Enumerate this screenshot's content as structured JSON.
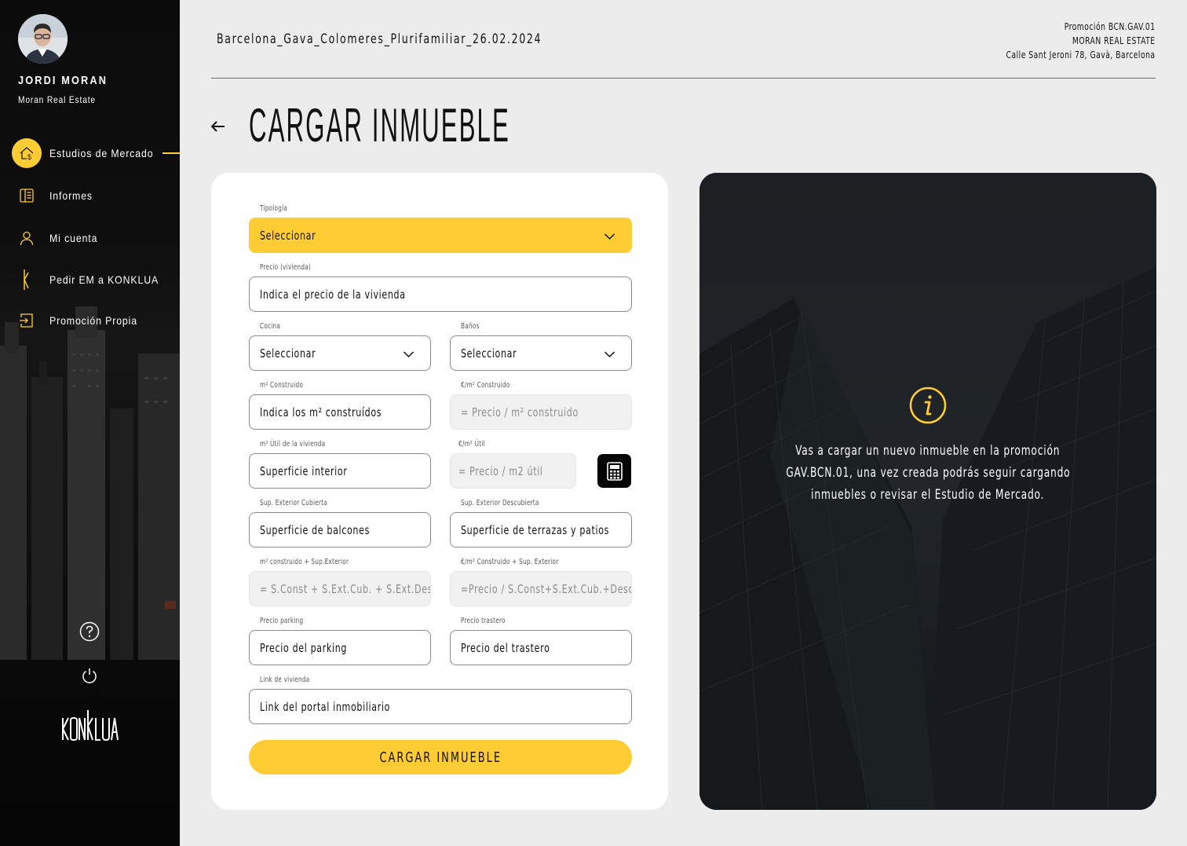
{
  "user": {
    "name": "JORDI MORAN",
    "company": "Moran Real Estate"
  },
  "sidebar": {
    "items": [
      {
        "label": "Estudios de Mercado",
        "icon": "house-euro-icon",
        "active": true
      },
      {
        "label": "Informes",
        "icon": "report-icon",
        "active": false
      },
      {
        "label": "Mi cuenta",
        "icon": "user-icon",
        "active": false
      },
      {
        "label": "Pedir EM a KONKLUA",
        "icon": "konklua-k-icon",
        "active": false
      },
      {
        "label": "Promoción Propia",
        "icon": "promotion-icon",
        "active": false
      }
    ],
    "logo": "KONKLUA"
  },
  "header": {
    "project": "Barcelona_Gava_Colomeres_Plurifamiliar_26.02.2024",
    "right": {
      "promotion": "Promoción BCN.GAV.01",
      "company": "MORAN REAL ESTATE",
      "address": "Calle Sant Jeroni 78, Gavà, Barcelona"
    }
  },
  "page": {
    "title": "CARGAR INMUEBLE"
  },
  "form": {
    "tipologia": {
      "label": "Tipología",
      "value": "Seleccionar"
    },
    "precio": {
      "label": "Precio (vivienda)",
      "placeholder": "Indica el precio de la vivienda"
    },
    "cocina": {
      "label": "Cocina",
      "value": "Seleccionar"
    },
    "banos": {
      "label": "Baños",
      "value": "Seleccionar"
    },
    "m2_construido": {
      "label": "m² Construido",
      "placeholder": "Indica los m² construídos"
    },
    "eur_m2_construido": {
      "label": "€/m² Construido",
      "placeholder": "= Precio / m² construido"
    },
    "m2_util": {
      "label": "m² Útil de la vivienda",
      "placeholder": "Superficie interior"
    },
    "eur_m2_util": {
      "label": "€/m² Útil",
      "placeholder": "= Precio / m2 útil"
    },
    "sup_ext_cubierta": {
      "label": "Sup. Exterior Cubierta",
      "placeholder": "Superficie de balcones"
    },
    "sup_ext_descubierta": {
      "label": "Sup. Exterior Descubierta",
      "placeholder": "Superficie de terrazas y patios"
    },
    "m2_const_sup_ext": {
      "label": "m² construido + Sup.Exterior",
      "placeholder": "= S.Const + S.Ext.Cub. + S.Ext.Desc."
    },
    "eur_m2_const_sup_ext": {
      "label": "€/m² Construido + Sup. Exterior",
      "placeholder": "=Precio / S.Const+S.Ext.Cub.+Desc."
    },
    "precio_parking": {
      "label": "Precio parking",
      "placeholder": "Precio del parking"
    },
    "precio_trastero": {
      "label": "Precio trastero",
      "placeholder": "Precio del trastero"
    },
    "link": {
      "label": "Link de vivienda",
      "placeholder": "Link del portal inmobiliario"
    },
    "submit": "CARGAR INMUEBLE"
  },
  "info": {
    "lines": [
      "Vas a cargar un nuevo inmueble en la promoción",
      "GAV.BCN.01, una vez creada podrás seguir cargando",
      "inmuebles o revisar el Estudio de Mercado."
    ]
  },
  "colors": {
    "accent": "#ffcc33",
    "sidebar": "#0b0b0b",
    "background": "#ececec"
  }
}
